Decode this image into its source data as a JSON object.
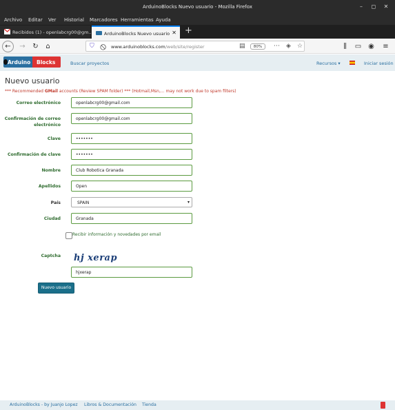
{
  "window": {
    "title": "ArduinoBlocks Nuevo usuario - Mozilla Firefox",
    "minimize": "–",
    "maximize": "◻",
    "close": "✕"
  },
  "menu": [
    "Archivo",
    "Editar",
    "Ver",
    "Historial",
    "Marcadores",
    "Herramientas",
    "Ayuda"
  ],
  "tabs": [
    {
      "label": "Recibidos (1) - openlabcrg00@gm...",
      "icon": "gmail-icon"
    },
    {
      "label": "ArduinoBlocks Nuevo usuario",
      "icon": "arduinoblocks-icon",
      "active": true
    }
  ],
  "nav": {
    "url_host": "www.arduinoblocks.com",
    "url_path": "/web/site/register",
    "zoom": "80%"
  },
  "site": {
    "logo_part1": "Arduino",
    "logo_part2": "Blocks",
    "nav_link": "Buscar proyectos",
    "resources": "Recursos ▾",
    "login": "Iniciar sesión"
  },
  "form": {
    "title": "Nuevo usuario",
    "warning_prefix": "*** Recommended ",
    "warning_bold": "GMail",
    "warning_suffix": " accounts (Review SPAM folder) *** (Hotmail,Msn,... may not work due to spam filters)",
    "email_label": "Correo electrónico",
    "email_value": "openlabcrg00@gmail.com",
    "email_confirm_label": "Confirmación de correo electrónico",
    "email_confirm_value": "openlabcrg00@gmail.com",
    "password_label": "Clave",
    "password_value": "•••••••",
    "password_confirm_label": "Confirmación de clave",
    "password_confirm_value": "•••••••",
    "name_label": "Nombre",
    "name_value": "Club Robotica Granada",
    "surname_label": "Apellidos",
    "surname_value": "Open",
    "country_label": "País",
    "country_value": "SPAIN",
    "city_label": "Ciudad",
    "city_value": "Granada",
    "newsletter_label": "Recibir información y novedades por email",
    "captcha_label": "Captcha",
    "captcha_image_text": "hj xerap",
    "captcha_value": "hjxerap",
    "submit_label": "Nuevo usuario"
  },
  "footer": {
    "credit": "ArduinoBlocks - by Juanjo Lopez",
    "docs": "Libros & Documentación",
    "store": "Tienda"
  }
}
